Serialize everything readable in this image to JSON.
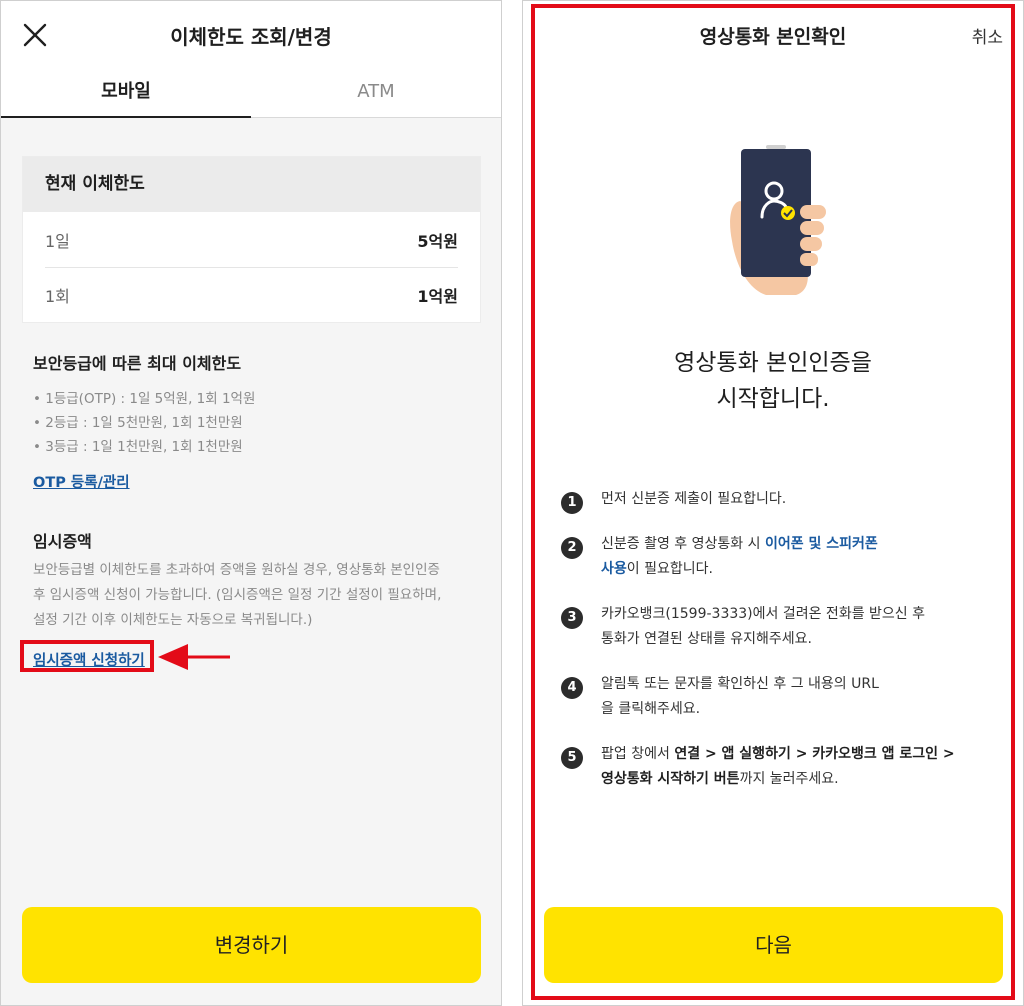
{
  "left": {
    "title": "이체한도 조회/변경",
    "tabs": [
      "모바일",
      "ATM"
    ],
    "current_limit": {
      "heading": "현재 이체한도",
      "rows": [
        {
          "label": "1일",
          "value": "5억원"
        },
        {
          "label": "1회",
          "value": "1억원"
        }
      ]
    },
    "security": {
      "heading": "보안등급에 따른 최대 이체한도",
      "items": [
        "• 1등급(OTP) : 1일 5억원, 1회 1억원",
        "• 2등급 : 1일 5천만원, 1회 1천만원",
        "• 3등급 : 1일 1천만원, 1회 1천만원"
      ],
      "otp_link": "OTP 등록/관리"
    },
    "temp": {
      "heading": "임시증액",
      "desc_lines": [
        "보안등급별 이체한도를 초과하여 증액을 원하실 경우, 영상통화 본인인증",
        "후 임시증액 신청이 가능합니다. (임시증액은 일정 기간 설정이 필요하며,",
        "설정 기간 이후 이체한도는 자동으로 복귀됩니다.)"
      ],
      "apply_link": "임시증액 신청하기"
    },
    "change_button": "변경하기"
  },
  "right": {
    "title": "영상통화 본인확인",
    "cancel": "취소",
    "headline_line1": "영상통화 본인인증을",
    "headline_line2": "시작합니다.",
    "steps": {
      "s1": {
        "num": "1",
        "text": "먼저 신분증 제출이 필요합니다."
      },
      "s2": {
        "num": "2",
        "pre": "신분증 촬영 후 영상통화 시 ",
        "em1": "이어폰 및 스피커폰",
        "em2": "사용",
        "post": "이 필요합니다."
      },
      "s3": {
        "num": "3",
        "line1": "카카오뱅크(1599-3333)에서 걸려온 전화를 받으신 후",
        "line2": "통화가 연결된 상태를 유지해주세요."
      },
      "s4": {
        "num": "4",
        "line1": "알림톡 또는 문자를 확인하신 후 그 내용의 URL",
        "line2": "을 클릭해주세요."
      },
      "s5": {
        "num": "5",
        "pre": "팝업 창에서 ",
        "em1": "연결 > 앱 실행하기 > 카카오뱅크 앱 로그인 >",
        "em2": "영상통화 시작하기 버튼",
        "post": "까지 눌러주세요."
      }
    },
    "next_button": "다음"
  },
  "colors": {
    "accent_yellow": "#ffe300",
    "highlight_red": "#e30b18",
    "link_blue": "#1a5aa0"
  }
}
